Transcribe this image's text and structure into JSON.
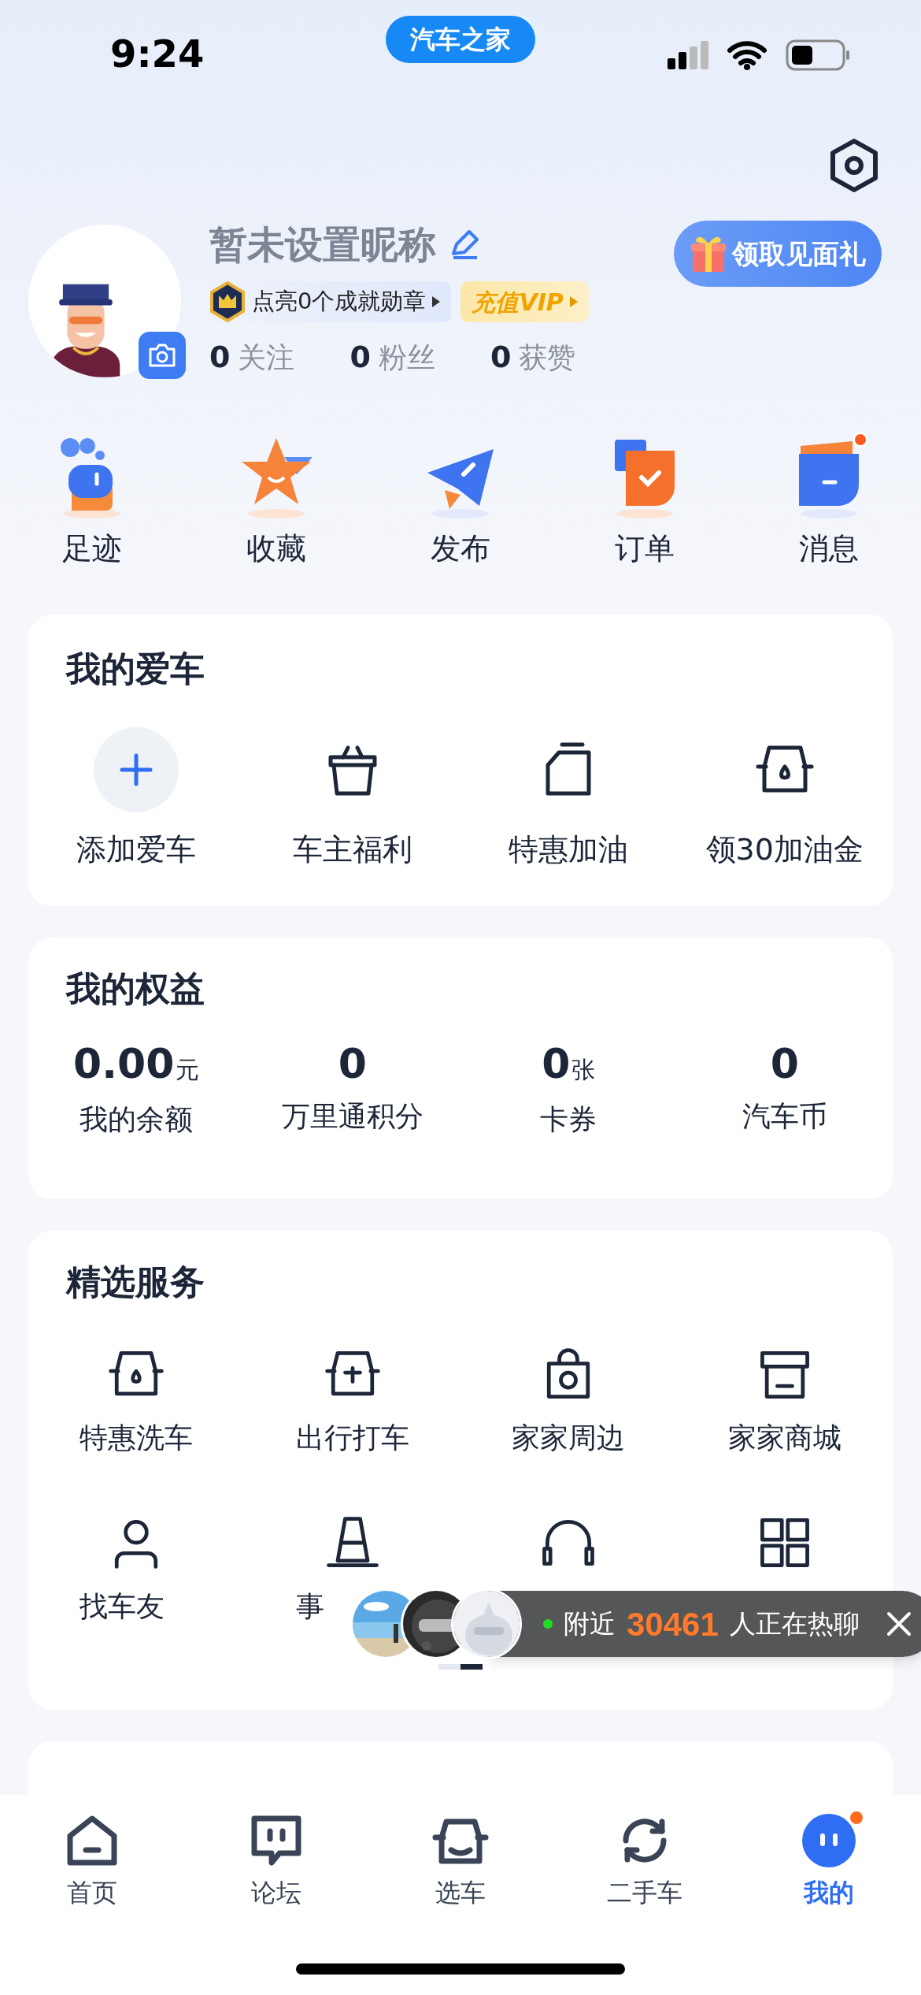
{
  "status_bar": {
    "time": "9:24",
    "app_pill": "汽车之家"
  },
  "profile": {
    "nickname": "暂未设置昵称",
    "achievement": "点亮0个成就勋章",
    "vip": "充值VIP",
    "gift_button": "领取见面礼",
    "stats": [
      {
        "value": "0",
        "label": "关注"
      },
      {
        "value": "0",
        "label": "粉丝"
      },
      {
        "value": "0",
        "label": "获赞"
      }
    ]
  },
  "shortcuts": [
    {
      "label": "足迹",
      "kind": "footprint",
      "badge": false
    },
    {
      "label": "收藏",
      "kind": "star",
      "badge": false
    },
    {
      "label": "发布",
      "kind": "plane",
      "badge": false
    },
    {
      "label": "订单",
      "kind": "order",
      "badge": false
    },
    {
      "label": "消息",
      "kind": "message",
      "badge": true
    }
  ],
  "my_car": {
    "title": "我的爱车",
    "items": [
      {
        "label": "添加爱车",
        "kind": "add"
      },
      {
        "label": "车主福利",
        "kind": "basket"
      },
      {
        "label": "特惠加油",
        "kind": "fuel"
      },
      {
        "label": "领30加油金",
        "kind": "seat"
      }
    ]
  },
  "benefits": {
    "title": "我的权益",
    "items": [
      {
        "value": "0.00",
        "unit": "元",
        "label": "我的余额"
      },
      {
        "value": "0",
        "label": "万里通积分"
      },
      {
        "value": "0",
        "unit": "张",
        "label": "卡券"
      },
      {
        "value": "0",
        "label": "汽车币"
      }
    ]
  },
  "services": {
    "title": "精选服务",
    "items": [
      {
        "label": "特惠洗车",
        "kind": "seat"
      },
      {
        "label": "出行打车",
        "kind": "ticket"
      },
      {
        "label": "家家周边",
        "kind": "bag"
      },
      {
        "label": "家家商城",
        "kind": "shop"
      },
      {
        "label": "找车友",
        "kind": "person"
      },
      {
        "label": "事",
        "kind": "cone"
      },
      {
        "kind": "headset"
      },
      {
        "kind": "grid"
      }
    ],
    "pages": [
      {
        "selected": false
      },
      {
        "selected": true
      }
    ]
  },
  "chat_banner": {
    "prefix": "附近",
    "count": "30461",
    "suffix": "人正在热聊"
  },
  "tab_bar": [
    {
      "label": "首页",
      "kind": "home",
      "selected": false,
      "badge": false
    },
    {
      "label": "论坛",
      "kind": "forum",
      "selected": false,
      "badge": false
    },
    {
      "label": "选车",
      "kind": "car",
      "selected": false,
      "badge": false
    },
    {
      "label": "二手车",
      "kind": "swap",
      "selected": false,
      "badge": false
    },
    {
      "label": "我的",
      "kind": "me",
      "selected": true,
      "badge": true
    }
  ]
}
